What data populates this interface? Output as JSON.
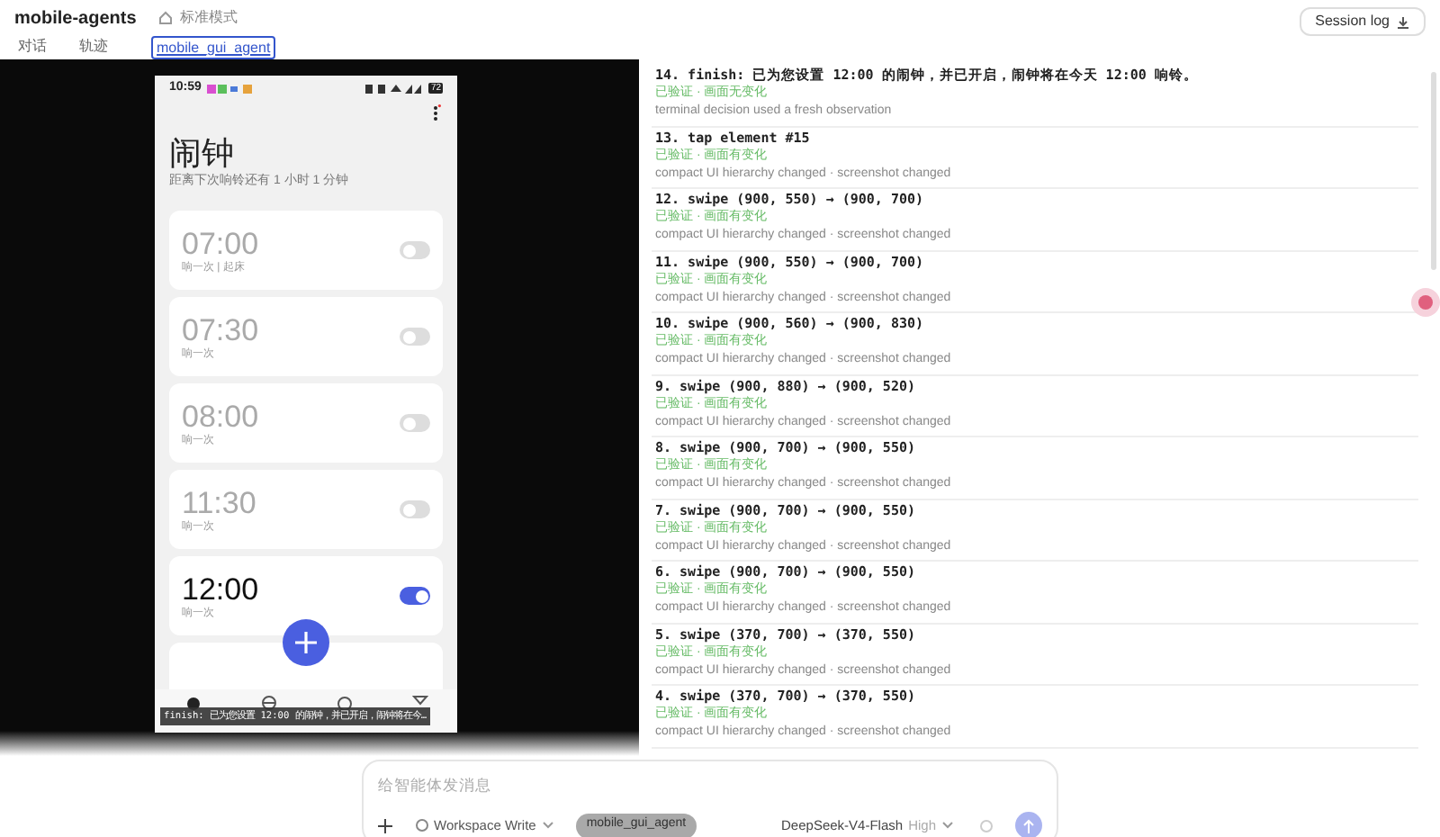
{
  "header": {
    "title": "mobile-agents",
    "mode": "标准模式",
    "session_log": "Session log"
  },
  "tabs": [
    {
      "label": "对话",
      "selected": false
    },
    {
      "label": "轨迹",
      "selected": false
    },
    {
      "label": "mobile_gui_agent",
      "selected": true
    }
  ],
  "phone": {
    "status_time": "10:59",
    "battery": "72",
    "title": "闹钟",
    "subtitle": "距离下次响铃还有 1 小时 1 分钟",
    "alarms": [
      {
        "time": "07:00",
        "note": "响一次 | 起床",
        "on": false
      },
      {
        "time": "07:30",
        "note": "响一次",
        "on": false
      },
      {
        "time": "08:00",
        "note": "响一次",
        "on": false
      },
      {
        "time": "11:30",
        "note": "响一次",
        "on": false
      },
      {
        "time": "12:00",
        "note": "响一次",
        "on": true
      }
    ],
    "caption": "finish: 已为您设置 12:00 的闹钟，并已开启，闹钟将在今…"
  },
  "steps": [
    {
      "title": "14. finish: 已为您设置 12:00 的闹钟，并已开启，闹钟将在今天 12:00 响铃。",
      "status": "已验证 · 画面无变化",
      "note": "terminal decision used a fresh observation"
    },
    {
      "title": "13. tap element #15",
      "status": "已验证 · 画面有变化",
      "note": "compact UI hierarchy changed · screenshot changed"
    },
    {
      "title": "12. swipe (900, 550) → (900, 700)",
      "status": "已验证 · 画面有变化",
      "note": "compact UI hierarchy changed · screenshot changed"
    },
    {
      "title": "11. swipe (900, 550) → (900, 700)",
      "status": "已验证 · 画面有变化",
      "note": "compact UI hierarchy changed · screenshot changed"
    },
    {
      "title": "10. swipe (900, 560) → (900, 830)",
      "status": "已验证 · 画面有变化",
      "note": "compact UI hierarchy changed · screenshot changed"
    },
    {
      "title": "9. swipe (900, 880) → (900, 520)",
      "status": "已验证 · 画面有变化",
      "note": "compact UI hierarchy changed · screenshot changed"
    },
    {
      "title": "8. swipe (900, 700) → (900, 550)",
      "status": "已验证 · 画面有变化",
      "note": "compact UI hierarchy changed · screenshot changed"
    },
    {
      "title": "7. swipe (900, 700) → (900, 550)",
      "status": "已验证 · 画面有变化",
      "note": "compact UI hierarchy changed · screenshot changed"
    },
    {
      "title": "6. swipe (900, 700) → (900, 550)",
      "status": "已验证 · 画面有变化",
      "note": "compact UI hierarchy changed · screenshot changed"
    },
    {
      "title": "5. swipe (370, 700) → (370, 550)",
      "status": "已验证 · 画面有变化",
      "note": "compact UI hierarchy changed · screenshot changed"
    },
    {
      "title": "4. swipe (370, 700) → (370, 550)",
      "status": "已验证 · 画面有变化",
      "note": "compact UI hierarchy changed · screenshot changed"
    }
  ],
  "composer": {
    "placeholder": "给智能体发消息",
    "permission": "Workspace Write",
    "agent_chip": "mobile_gui_agent",
    "model": "DeepSeek-V4-Flash",
    "effort": "High"
  }
}
